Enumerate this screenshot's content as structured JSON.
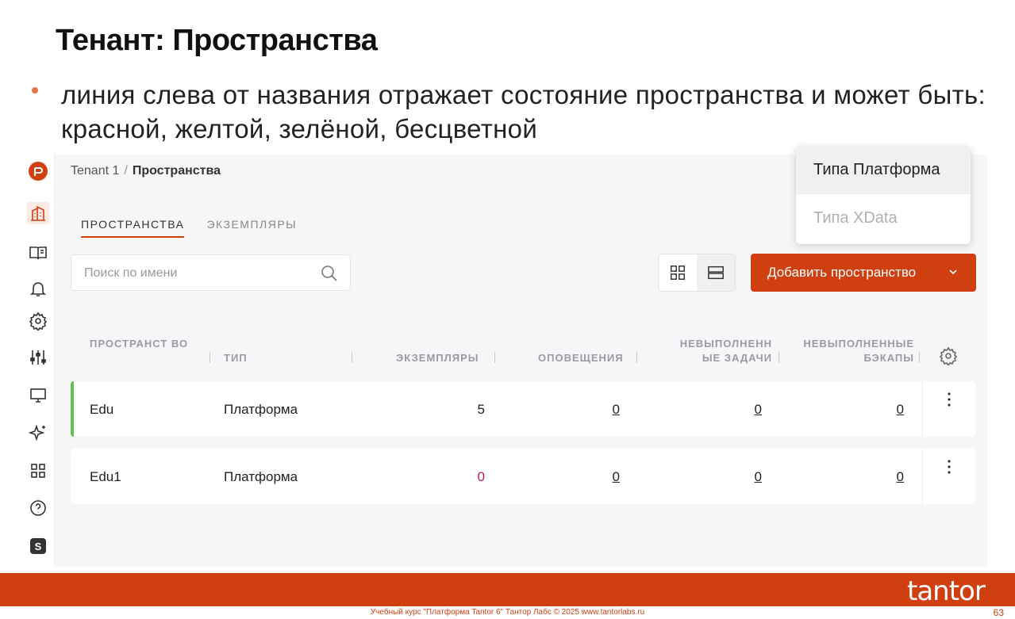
{
  "slide": {
    "title": "Тенант: Пространства",
    "bullet": "линия слева от названия отражает состояние пространства и может быть: красной, желтой, зелёной, бесцветной",
    "footer": "Учебный курс \"Платформа Tantor 6\" Тантор Лабс © 2025 www.tantorlabs.ru",
    "page_number": "63",
    "logo_text": "tantor"
  },
  "colors": {
    "accent": "#cf3f10",
    "status_green": "#62c24a",
    "alert_red": "#c2185b"
  },
  "nav": {
    "items": [
      {
        "name": "logo-icon"
      },
      {
        "name": "buildings-icon"
      },
      {
        "name": "book-icon"
      },
      {
        "name": "bell-icon"
      },
      {
        "name": "gear-icon"
      },
      {
        "name": "sliders-icon"
      },
      {
        "name": "monitor-icon"
      },
      {
        "name": "sparkle-icon"
      },
      {
        "name": "grid-icon"
      },
      {
        "name": "help-icon"
      },
      {
        "name": "s-icon",
        "label": "S"
      }
    ]
  },
  "breadcrumb": {
    "root": "Tenant 1",
    "separator": "/",
    "current": "Пространства"
  },
  "tabs": [
    {
      "label": "ПРОСТРАНСТВА",
      "active": true
    },
    {
      "label": "ЭКЗЕМПЛЯРЫ",
      "active": false
    }
  ],
  "search": {
    "placeholder": "Поиск по имени",
    "value": ""
  },
  "add_button": {
    "label": "Добавить пространство"
  },
  "dropdown": {
    "items": [
      {
        "label": "Типа Платформа",
        "state": "hover"
      },
      {
        "label": "Типа XData",
        "state": "disabled"
      }
    ]
  },
  "table": {
    "columns": [
      {
        "label": "ПРОСТРАНСТ ВО"
      },
      {
        "label": "ТИП"
      },
      {
        "label": "ЭКЗЕМПЛЯРЫ"
      },
      {
        "label": "ОПОВЕЩЕНИЯ"
      },
      {
        "label": "НЕВЫПОЛНЕНН ЫЕ ЗАДАЧИ"
      },
      {
        "label": "НЕВЫПОЛНЕННЫЕ БЭКАПЫ"
      }
    ],
    "rows": [
      {
        "name": "Edu",
        "type": "Платформа",
        "instances": "5",
        "alerts": "0",
        "failed_tasks": "0",
        "failed_backups": "0",
        "status": "green"
      },
      {
        "name": "Edu1",
        "type": "Платформа",
        "instances": "0",
        "alerts": "0",
        "failed_tasks": "0",
        "failed_backups": "0",
        "status": "none"
      }
    ]
  }
}
